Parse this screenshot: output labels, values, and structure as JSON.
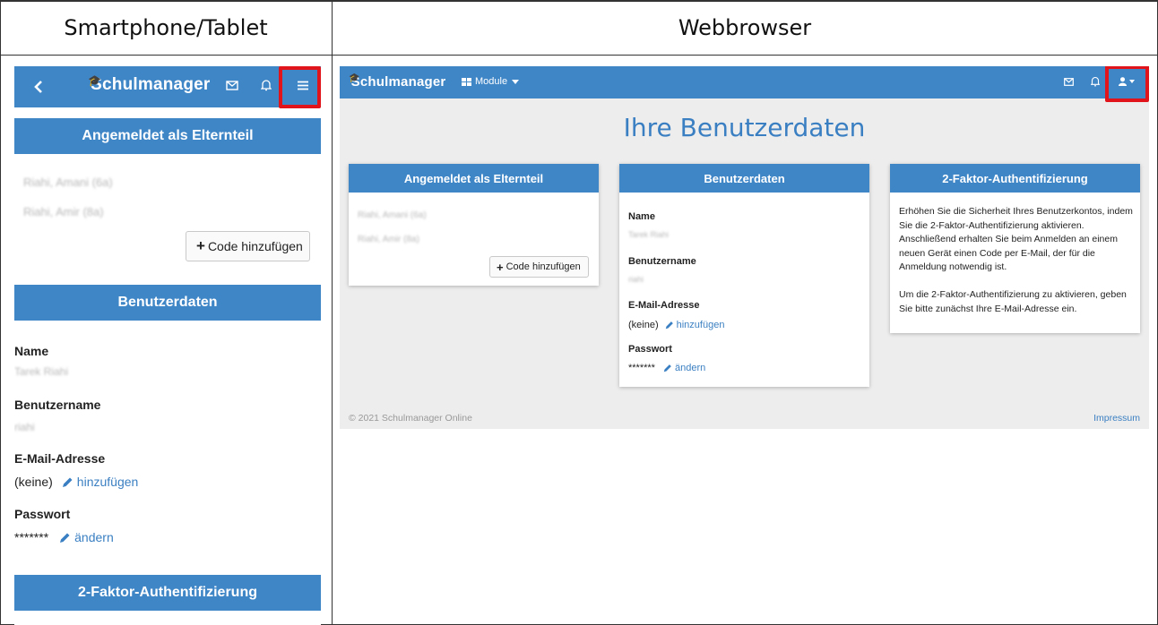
{
  "columns": {
    "left": "Smartphone/Tablet",
    "right": "Webbrowser"
  },
  "phone": {
    "brand": "Schulmanager",
    "parent_header": "Angemeldet als Elternteil",
    "children": [
      "Riahi, Amani (6a)",
      "Riahi, Amir (8a)"
    ],
    "code_button": "Code hinzufügen",
    "userdata_header": "Benutzerdaten",
    "name_label": "Name",
    "name_value": "Tarek Riahi",
    "username_label": "Benutzername",
    "username_value": "riahi",
    "email_label": "E-Mail-Adresse",
    "email_value": "(keine)",
    "email_link": "hinzufügen",
    "password_label": "Passwort",
    "password_value": "*******",
    "password_link": "ändern",
    "twofa_header": "2-Faktor-Authentifizierung"
  },
  "web": {
    "brand": "Schulmanager",
    "module_menu": "Module",
    "page_title": "Ihre Benutzerdaten",
    "parent_card": {
      "header": "Angemeldet als Elternteil",
      "children": [
        "Riahi, Amani (6a)",
        "Riahi, Amir (8a)"
      ],
      "code_button": "Code hinzufügen"
    },
    "userdata_card": {
      "header": "Benutzerdaten",
      "name_label": "Name",
      "name_value": "Tarek Riahi",
      "username_label": "Benutzername",
      "username_value": "riahi",
      "email_label": "E-Mail-Adresse",
      "email_value": "(keine)",
      "email_link": "hinzufügen",
      "password_label": "Passwort",
      "password_value": "*******",
      "password_link": "ändern"
    },
    "twofa_card": {
      "header": "2-Faktor-Authentifizierung",
      "para1": "Erhöhen Sie die Sicherheit Ihres Benutzerkontos, indem Sie die 2-Faktor-Authentifizierung aktivieren. Anschließend erhalten Sie beim Anmelden an einem neuen Gerät einen Code per E-Mail, der für die Anmeldung notwendig ist.",
      "para2": "Um die 2-Faktor-Authentifizierung zu aktivieren, geben Sie bitte zunächst Ihre E-Mail-Adresse ein."
    },
    "footer_copyright": "© 2021 Schulmanager Online",
    "footer_link": "Impressum"
  },
  "icons": {
    "back": "chevron-left-icon",
    "mail": "envelope-icon",
    "bell": "bell-icon",
    "menu": "hamburger-icon",
    "user": "user-icon",
    "modules": "grid-icon",
    "plus": "plus-icon",
    "pencil": "pencil-icon"
  },
  "colors": {
    "brand_blue": "#3f86c7",
    "highlight_red": "#e0141a",
    "link": "#3a7fc2",
    "web_background": "#ededed"
  }
}
